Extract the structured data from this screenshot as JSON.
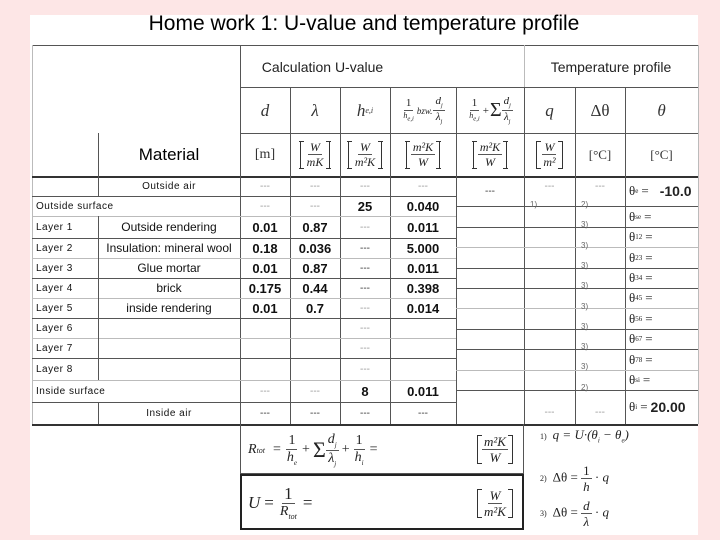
{
  "title": "Home work 1: U-value and temperature profile",
  "sections": {
    "calculation": "Calculation U-value",
    "temperature": "Temperature profile"
  },
  "columns": {
    "d": {
      "symbol": "d",
      "unit": "[m]"
    },
    "lambda": {
      "symbol": "λ",
      "unit_num": "W",
      "unit_den": "mK"
    },
    "h": {
      "symbol": "h",
      "sub": "e,i",
      "unit_num": "W",
      "unit_den": "m²K"
    },
    "r": {
      "symbol_num": "1",
      "symbol_den": "h_e,i",
      "mid": "bzw.",
      "symbol_num2": "d_j",
      "symbol_den2": "λ_j",
      "unit_num": "m²K",
      "unit_den": "W"
    },
    "sum": {
      "symbol": "1/h_e,i + Σ d_j/λ_j",
      "unit_num": "m²K",
      "unit_den": "W"
    },
    "q": {
      "symbol": "q",
      "unit_num": "W",
      "unit_den": "m²"
    },
    "dtheta": {
      "symbol": "Δθ",
      "unit": "[°C]"
    },
    "theta": {
      "symbol": "θ",
      "unit": "[°C]"
    }
  },
  "material_header": "Material",
  "rows": [
    {
      "label": "",
      "material": "Outside air",
      "d": "---",
      "lambda": "---",
      "h": "---",
      "r": "---"
    },
    {
      "label": "Outside surface",
      "material": "",
      "d": "---",
      "lambda": "---",
      "h": "25",
      "r": "0.040"
    },
    {
      "label": "Layer 1",
      "material": "Outside rendering",
      "d": "0.01",
      "lambda": "0.87",
      "h": "---",
      "r": "0.011"
    },
    {
      "label": "Layer 2",
      "material": "Insulation: mineral wool",
      "d": "0.18",
      "lambda": "0.036",
      "h": "---",
      "r": "5.000"
    },
    {
      "label": "Layer 3",
      "material": "Glue mortar",
      "d": "0.01",
      "lambda": "0.87",
      "h": "---",
      "r": "0.011"
    },
    {
      "label": "Layer 4",
      "material": "brick",
      "d": "0.175",
      "lambda": "0.44",
      "h": "---",
      "r": "0.398"
    },
    {
      "label": "Layer 5",
      "material": "inside rendering",
      "d": "0.01",
      "lambda": "0.7",
      "h": "---",
      "r": "0.014"
    },
    {
      "label": "Layer 6",
      "material": "",
      "d": "",
      "lambda": "",
      "h": "---",
      "r": ""
    },
    {
      "label": "Layer  7",
      "material": "",
      "d": "",
      "lambda": "",
      "h": "---",
      "r": ""
    },
    {
      "label": "Layer  8",
      "material": "",
      "d": "",
      "lambda": "",
      "h": "---",
      "r": ""
    },
    {
      "label": "Inside surface",
      "material": "",
      "d": "---",
      "lambda": "---",
      "h": "8",
      "r": "0.011"
    },
    {
      "label": "",
      "material": "Inside air",
      "d": "---",
      "lambda": "---",
      "h": "---",
      "r": "---"
    }
  ],
  "sum_top": "---",
  "q_top": "---",
  "dtheta_top": "---",
  "q_bottom": "---",
  "dtheta_bottom": "---",
  "q_step": "1)",
  "dtheta_steps": [
    "2)",
    "3)",
    "3)",
    "3)",
    "3)",
    "3)",
    "3)",
    "3)",
    "3)",
    "2)"
  ],
  "theta_labels": [
    {
      "sym": "θ",
      "sub": "e",
      "eq": "=",
      "value": "-10.0"
    },
    {
      "sym": "θ",
      "sub": "se",
      "eq": "=",
      "value": ""
    },
    {
      "sym": "θ",
      "sub": "12",
      "eq": "=",
      "value": ""
    },
    {
      "sym": "θ",
      "sub": "23",
      "eq": "=",
      "value": ""
    },
    {
      "sym": "θ",
      "sub": "34",
      "eq": "=",
      "value": ""
    },
    {
      "sym": "θ",
      "sub": "45",
      "eq": "=",
      "value": ""
    },
    {
      "sym": "θ",
      "sub": "56",
      "eq": "=",
      "value": ""
    },
    {
      "sym": "θ",
      "sub": "67",
      "eq": "=",
      "value": ""
    },
    {
      "sym": "θ",
      "sub": "78",
      "eq": "=",
      "value": ""
    },
    {
      "sym": "θ",
      "sub": "si",
      "eq": "=",
      "value": ""
    },
    {
      "sym": "θ",
      "sub": "i",
      "eq": "=",
      "value": "20.00"
    }
  ],
  "formulas": {
    "rtot": {
      "lhs": "R",
      "lhs_sub": "tot",
      "text": "= 1/h_e + Σ d_j/λ_j + 1/h_i =",
      "unit_num": "m²K",
      "unit_den": "W"
    },
    "u": {
      "lhs": "U",
      "text": "= 1/R_tot =",
      "unit_num": "W",
      "unit_den": "m²K"
    }
  },
  "notes": [
    {
      "num": "1)",
      "text": "q = U·(θi − θe)"
    },
    {
      "num": "2)",
      "text": "Δθ = 1/h · q"
    },
    {
      "num": "3)",
      "text": "Δθ = d/λ · q"
    }
  ]
}
